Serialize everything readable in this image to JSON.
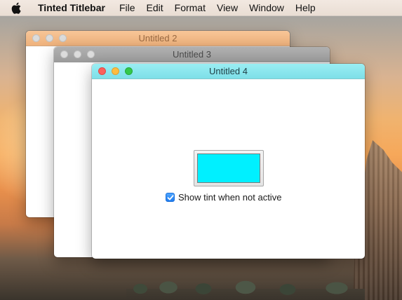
{
  "menubar": {
    "apple_icon": "apple-logo-icon",
    "app_name": "Tinted Titlebar",
    "items": [
      "File",
      "Edit",
      "Format",
      "View",
      "Window",
      "Help"
    ]
  },
  "windows": {
    "win2": {
      "title": "Untitled 2",
      "titlebar_color": "#f3bb88",
      "state": "inactive"
    },
    "win3": {
      "title": "Untitled 3",
      "titlebar_color": "#a6a6a6",
      "state": "inactive"
    },
    "win4": {
      "title": "Untitled 4",
      "titlebar_color": "#8ce6ee",
      "state": "active"
    }
  },
  "content": {
    "color_well_value": "#00f0ff",
    "checkbox_label": "Show tint when not active",
    "checkbox_checked": true
  }
}
